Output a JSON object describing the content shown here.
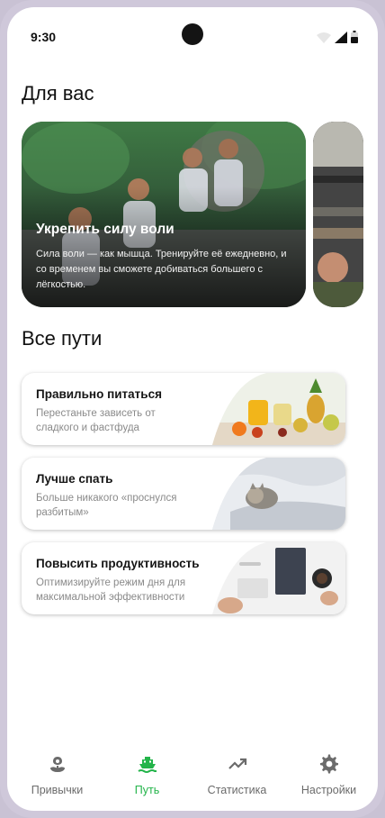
{
  "status": {
    "time": "9:30"
  },
  "for_you": {
    "heading": "Для вас",
    "cards": [
      {
        "title": "Укрепить силу воли",
        "description": "Сила воли — как мышца. Тренируйте её ежедневно, и со временем вы сможете добиваться большего с лёгкостью."
      }
    ]
  },
  "all_paths": {
    "heading": "Все пути",
    "items": [
      {
        "title": "Правильно питаться",
        "description": "Перестаньте зависеть от сладкого и фастфуда"
      },
      {
        "title": "Лучше спать",
        "description": "Больше никакого «проснулся разбитым»"
      },
      {
        "title": "Повысить продуктивность",
        "description": "Оптимизируйте режим дня для максимальной эффективности"
      }
    ]
  },
  "nav": {
    "active_color": "#23b44a",
    "items": [
      {
        "label": "Привычки",
        "icon": "flower-icon"
      },
      {
        "label": "Путь",
        "icon": "ship-icon",
        "active": true
      },
      {
        "label": "Статистика",
        "icon": "trending-up-icon"
      },
      {
        "label": "Настройки",
        "icon": "gear-icon"
      }
    ]
  }
}
